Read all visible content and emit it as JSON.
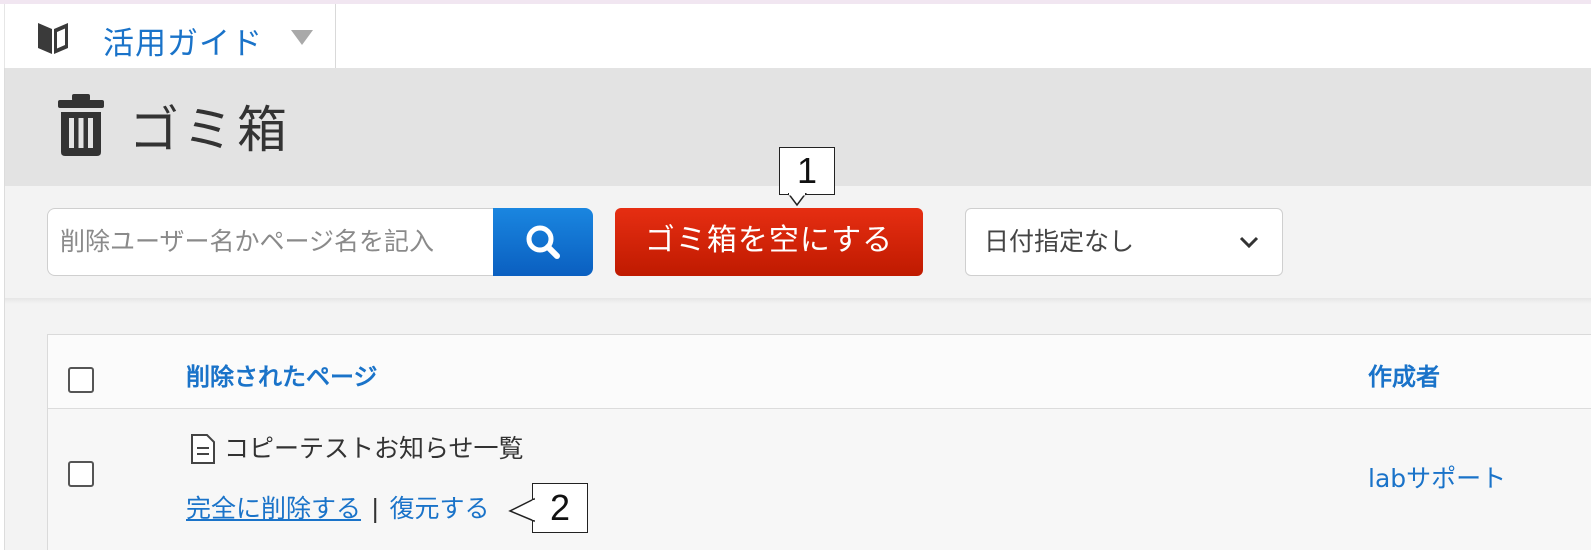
{
  "guide": {
    "label": "活用ガイド",
    "icon": "book-icon"
  },
  "page": {
    "title": "ゴミ箱",
    "icon": "trash-icon"
  },
  "toolbar": {
    "search_placeholder": "削除ユーザー名かページ名を記入",
    "empty_trash_label": "ゴミ箱を空にする",
    "date_filter_value": "日付指定なし"
  },
  "table": {
    "columns": {
      "page": "削除されたページ",
      "author": "作成者"
    },
    "rows": [
      {
        "title": "コピーテストお知らせ一覧",
        "delete_label": "完全に削除する",
        "separator": "|",
        "restore_label": "復元する",
        "author": "labサポート"
      }
    ]
  },
  "callouts": [
    "1",
    "2"
  ],
  "colors": {
    "accent_blue": "#1a73c9",
    "danger_red": "#d42208",
    "search_button": "#0a6fd0"
  }
}
